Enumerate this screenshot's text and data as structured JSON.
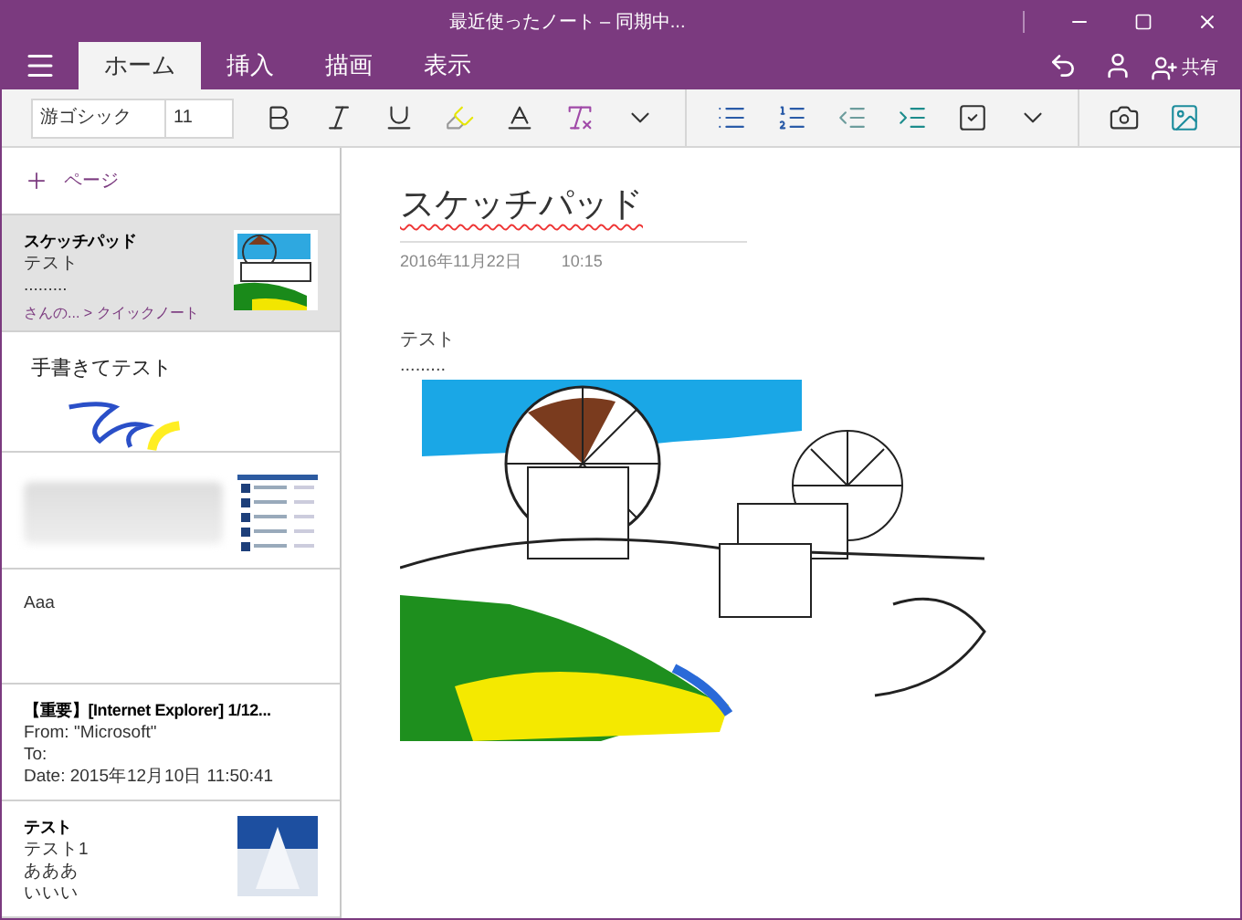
{
  "window": {
    "title": "最近使ったノート – 同期中..."
  },
  "tabs": [
    {
      "label": "ホーム",
      "selected": true
    },
    {
      "label": "挿入",
      "selected": false
    },
    {
      "label": "描画",
      "selected": false
    },
    {
      "label": "表示",
      "selected": false
    }
  ],
  "share_button": {
    "label": "共有"
  },
  "toolbar": {
    "font": "游ゴシック",
    "size": "11"
  },
  "sidebar": {
    "add_page": "ページ",
    "pages": [
      {
        "kind": "text",
        "selected": true,
        "title": "スケッチパッド",
        "lines": [
          "テスト",
          "........."
        ],
        "breadcrumb": "さんの... > クイックノート",
        "thumbnail": {
          "kind": "sketch"
        }
      },
      {
        "kind": "ink",
        "selected": false,
        "title": "手書きてテスト"
      },
      {
        "kind": "blurred",
        "selected": false,
        "thumbnail": {
          "kind": "web"
        }
      },
      {
        "kind": "plain",
        "selected": false,
        "title": "Aaa"
      },
      {
        "kind": "text",
        "selected": false,
        "title": "【重要】[Internet Explorer] 1/12...",
        "lines": [
          "From: \"Microsoft\"",
          "To:",
          "Date: 2015年12月10日 11:50:41"
        ]
      },
      {
        "kind": "text",
        "selected": false,
        "title": "テスト",
        "lines": [
          "テスト1",
          "あああ",
          "いいい"
        ],
        "thumbnail": {
          "kind": "snow"
        }
      }
    ]
  },
  "page": {
    "title": "スケッチパッド",
    "date": "2016年11月22日",
    "time": "10:15",
    "body": [
      "テスト",
      "........."
    ]
  }
}
